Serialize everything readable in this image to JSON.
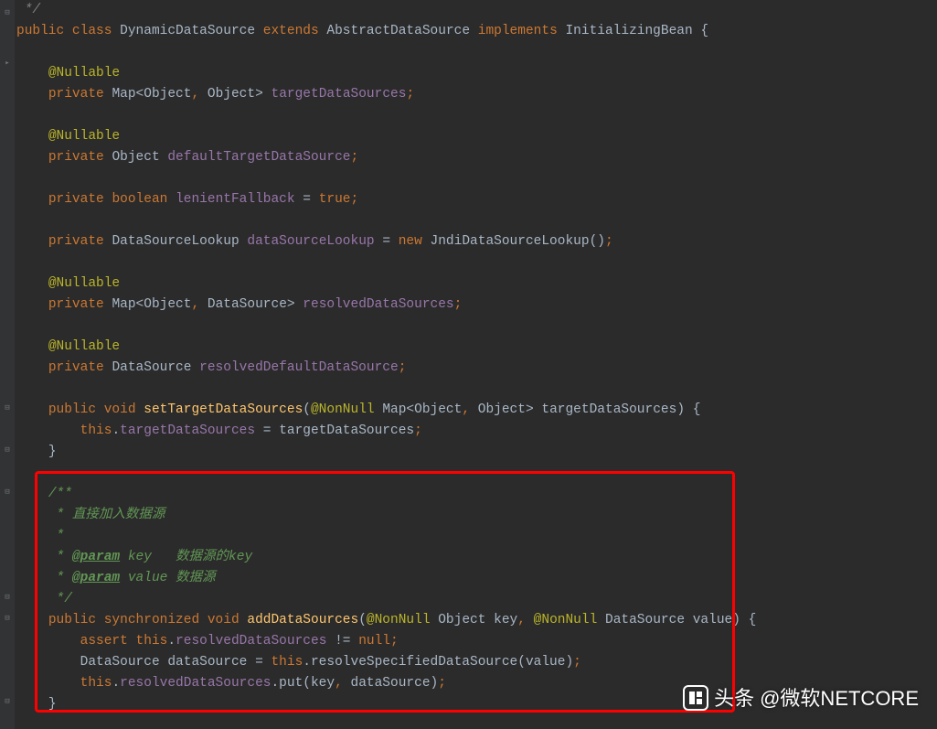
{
  "code": {
    "comment_close": " */",
    "class_decl": {
      "public": "public",
      "class": "class",
      "name": "DynamicDataSource",
      "extends": "extends",
      "super": "AbstractDataSource",
      "implements": "implements",
      "iface": "InitializingBean"
    },
    "nullable": "@Nullable",
    "private": "private",
    "map": "Map",
    "object": "Object",
    "datasource": "DataSource",
    "fields": {
      "targetDataSources": "targetDataSources",
      "defaultTargetDataSource": "defaultTargetDataSource",
      "lenientFallback": "lenientFallback",
      "dataSourceLookup": "dataSourceLookup",
      "resolvedDataSources": "resolvedDataSources",
      "resolvedDefaultDataSource": "resolvedDefaultDataSource"
    },
    "boolean": "boolean",
    "true": "true",
    "eq": "=",
    "dsLookup": "DataSourceLookup",
    "new": "new",
    "jndi": "JndiDataSourceLookup",
    "public_kw": "public",
    "void": "void",
    "setTarget": "setTargetDataSources",
    "nonnull": "@NonNull",
    "param_tds": "targetDataSources",
    "this": "this",
    "doc": {
      "open": "/**",
      "l1": " * 直接加入数据源",
      "l2": " *",
      "param": "@param",
      "key_name": "key",
      "key_desc": "   数据源的key",
      "val_name": "value",
      "val_desc": " 数据源",
      "close": " */"
    },
    "sync": "synchronized",
    "addDS": "addDataSources",
    "key": "key",
    "value": "value",
    "assert": "assert",
    "null": "null",
    "neq": "!=",
    "resolveSpec": "resolveSpecifiedDataSource",
    "local_ds": "dataSource",
    "put": "put"
  },
  "watermark": {
    "brand": "头条",
    "author": "@微软NETCORE"
  },
  "colors": {
    "keyword": "#cc7832",
    "annotation": "#bbb529",
    "field": "#9876aa",
    "method": "#ffc66d",
    "comment_grey": "#808080",
    "comment_green": "#629755",
    "bg": "#2b2b2b"
  },
  "highlight_box": {
    "top_line": 23,
    "bottom_line": 33
  }
}
